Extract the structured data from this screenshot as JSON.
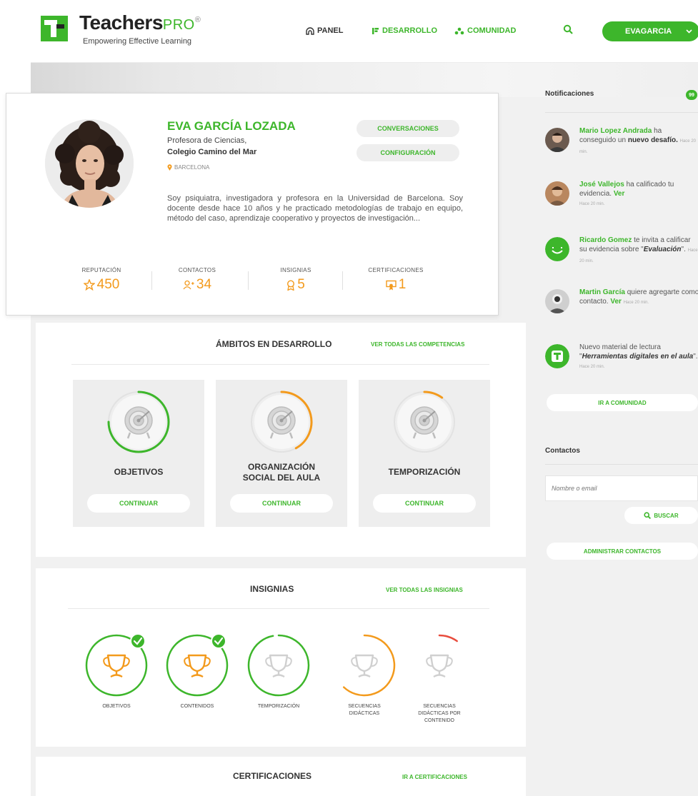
{
  "header": {
    "logo_name": "Teachers",
    "logo_pro": "PRO",
    "logo_reg": "®",
    "tagline": "Empowering Effective Learning",
    "nav": {
      "panel": "PANEL",
      "desarrollo": "DESARROLLO",
      "comunidad": "COMUNIDAD"
    },
    "user": "EVAGARCIA"
  },
  "profile": {
    "name": "EVA GARCÍA LOZADA",
    "role": "Profesora de Ciencias,",
    "school": "Colegio Camino del Mar",
    "city": "BARCELONA",
    "buttons": {
      "conversaciones": "CONVERSACIONES",
      "configuracion": "CONFIGURACIÓN"
    },
    "bio": "Soy psiquiatra, investigadora y profesora en la Universidad de Barcelona. Soy docente desde hace 10 años y he practicado metodologías de trabajo en equipo, método del caso, aprendizaje cooperativo y proyectos de investigación...",
    "stats": [
      {
        "label": "REPUTACIÓN",
        "value": "450"
      },
      {
        "label": "CONTACTOS",
        "value": "34"
      },
      {
        "label": "INSIGNIAS",
        "value": "5"
      },
      {
        "label": "CERTIFICACIONES",
        "value": "1"
      }
    ]
  },
  "ambitos": {
    "title": "ÁMBITOS EN DESARROLLO",
    "link": "VER TODAS LAS COMPETENCIAS",
    "items": [
      {
        "title_1": "OBJETIVOS",
        "title_2": "",
        "button": "CONTINUAR",
        "progress": 0.75,
        "color": "#3db62b"
      },
      {
        "title_1": "ORGANIZACIÓN",
        "title_2": "SOCIAL DEL AULA",
        "button": "CONTINUAR",
        "progress": 0.42,
        "color": "#f39a1c"
      },
      {
        "title_1": "TEMPORIZACIÓN",
        "title_2": "",
        "button": "CONTINUAR",
        "progress": 0.1,
        "color": "#f39a1c"
      }
    ]
  },
  "insignias": {
    "title": "INSIGNIAS",
    "link": "VER TODAS LAS INSIGNIAS",
    "items": [
      {
        "label_1": "OBJETIVOS",
        "label_2": "",
        "label_3": "",
        "progress": 1.0,
        "color": "#3db62b",
        "done": true
      },
      {
        "label_1": "CONTENIDOS",
        "label_2": "",
        "label_3": "",
        "progress": 1.0,
        "color": "#3db62b",
        "done": true
      },
      {
        "label_1": "TEMPORIZACIÓN",
        "label_2": "",
        "label_3": "",
        "progress": 0.97,
        "color": "#3db62b",
        "done": false
      },
      {
        "label_1": "SECUENCIAS",
        "label_2": "DIDÁCTICAS",
        "label_3": "",
        "progress": 0.62,
        "color": "#f39a1c",
        "done": false
      },
      {
        "label_1": "SECUENCIAS",
        "label_2": "DIDÁCTICAS POR",
        "label_3": "CONTENIDO",
        "progress": 0.1,
        "color": "#e84c3d",
        "done": false
      }
    ]
  },
  "certificaciones": {
    "title": "CERTIFICACIONES",
    "link": "IR A CERTIFICACIONES"
  },
  "notifications": {
    "title": "Notificaciones",
    "count": "99",
    "items": [
      {
        "name": "Mario Lopez Andrada",
        "text_1": " ha conseguido un ",
        "bold_1": "nuevo desafío.",
        "text_2": "",
        "time": "Hace 20 min."
      },
      {
        "name": "José Vallejos",
        "text_1": " ha calificado tu evidencia. ",
        "bold_1": "Ver",
        "text_2": "",
        "time": "Hace 20 min."
      },
      {
        "name": "Ricardo Gomez",
        "text_1": " te invita a calificar su evidencia sobre \"",
        "bold_1": "Evaluación",
        "text_2": "\".",
        "time": "Hace 20 min."
      },
      {
        "name": "Martin García",
        "text_1": " quiere agregarte como contacto. ",
        "bold_1": "Ver",
        "text_2": "",
        "time": "Hace 20 min."
      },
      {
        "name": "",
        "text_1": "Nuevo material de lectura \"",
        "bold_1": "Herramientas digitales en el aula",
        "text_2": "\".",
        "time": "Hace 20 min."
      }
    ],
    "community_button": "IR A COMUNIDAD"
  },
  "contacts": {
    "title": "Contactos",
    "placeholder": "Nombre o email",
    "search_button": "BUSCAR",
    "manage_button": "ADMINISTRAR CONTACTOS"
  }
}
